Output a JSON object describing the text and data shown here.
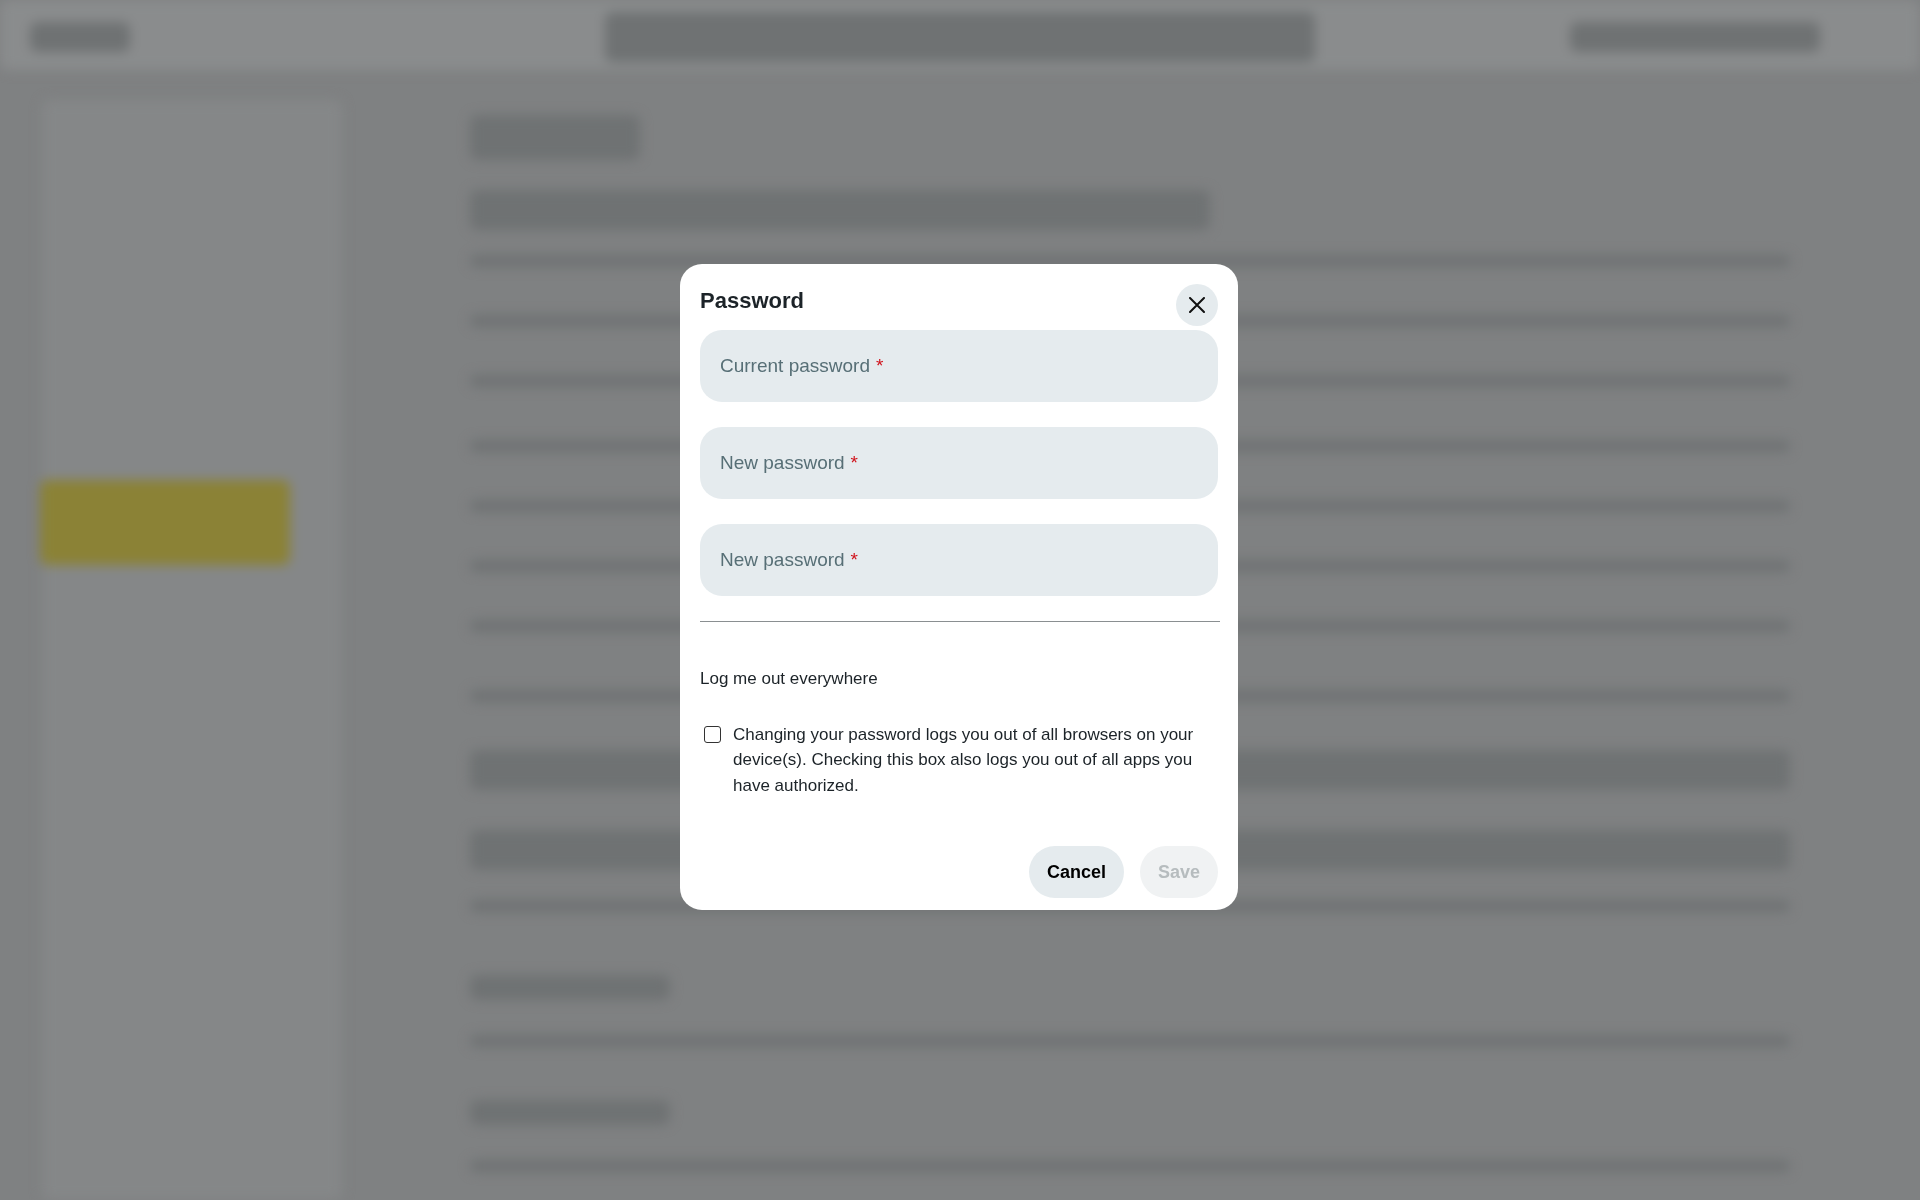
{
  "dialog": {
    "title": "Password",
    "fields": [
      {
        "label": "Current password",
        "required_mark": "*"
      },
      {
        "label": "New password",
        "required_mark": "*"
      },
      {
        "label": "New password",
        "required_mark": "*"
      }
    ],
    "section_label": "Log me out everywhere",
    "checkbox": {
      "label": "Changing your password logs you out of all browsers on your device(s). Checking this box also logs you out of all apps you have authorized.",
      "checked": false
    },
    "buttons": [
      {
        "label": "Cancel",
        "disabled": false
      },
      {
        "label": "Save",
        "disabled": true
      }
    ]
  }
}
